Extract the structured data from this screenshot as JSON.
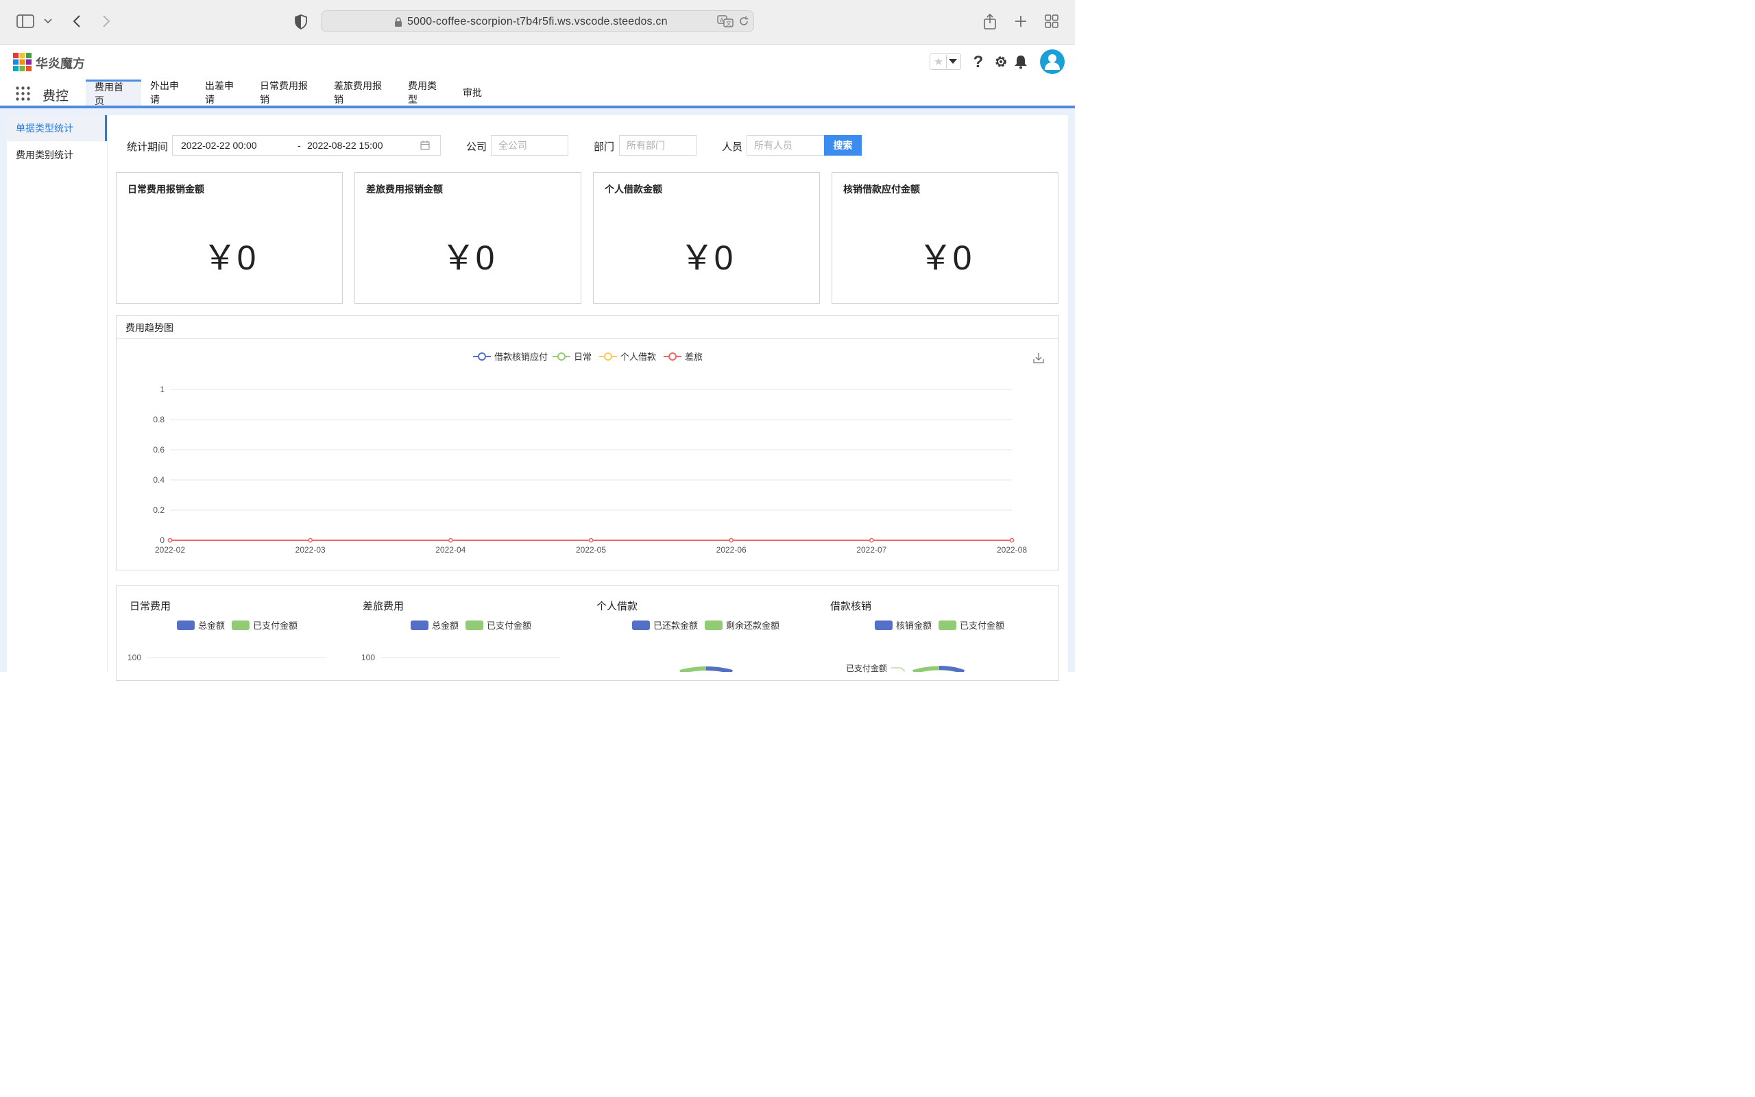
{
  "browser": {
    "url": "5000-coffee-scorpion-t7b4r5fi.ws.vscode.steedos.cn"
  },
  "app": {
    "brand": "华炎魔方",
    "title": "费控",
    "nav": [
      "费用首页",
      "外出申请",
      "出差申请",
      "日常费用报销",
      "差旅费用报销",
      "费用类型",
      "审批"
    ]
  },
  "sidebar": {
    "items": [
      "单据类型统计",
      "费用类别统计"
    ]
  },
  "filters": {
    "period_label": "统计期间",
    "start": "2022-02-22 00:00",
    "sep": "-",
    "end": "2022-08-22 15:00",
    "company_label": "公司",
    "company_placeholder": "全公司",
    "dept_label": "部门",
    "dept_placeholder": "所有部门",
    "person_label": "人员",
    "person_placeholder": "所有人员",
    "search": "搜索"
  },
  "cards": [
    {
      "title": "日常费用报销金额",
      "value": "￥0"
    },
    {
      "title": "差旅费用报销金额",
      "value": "￥0"
    },
    {
      "title": "个人借款金额",
      "value": "￥0"
    },
    {
      "title": "核销借款应付金额",
      "value": "￥0"
    }
  ],
  "trend": {
    "panel_title": "费用趋势图"
  },
  "chart_data": {
    "type": "line",
    "x": [
      "2022-02",
      "2022-03",
      "2022-04",
      "2022-05",
      "2022-06",
      "2022-07",
      "2022-08"
    ],
    "y_ticks": [
      "0",
      "0.2",
      "0.4",
      "0.6",
      "0.8",
      "1"
    ],
    "ylim": [
      0,
      1
    ],
    "grid": true,
    "legend_position": "top-center",
    "series": [
      {
        "name": "借款核销应付",
        "color": "#5470c6",
        "values": [
          0,
          0,
          0,
          0,
          0,
          0,
          0
        ]
      },
      {
        "name": "日常",
        "color": "#91cc75",
        "values": [
          0,
          0,
          0,
          0,
          0,
          0,
          0
        ]
      },
      {
        "name": "个人借款",
        "color": "#fac858",
        "values": [
          0,
          0,
          0,
          0,
          0,
          0,
          0
        ]
      },
      {
        "name": "差旅",
        "color": "#ee6666",
        "values": [
          0,
          0,
          0,
          0,
          0,
          0,
          0
        ]
      }
    ]
  },
  "bottom": {
    "charts": [
      {
        "title": "日常费用",
        "legend": [
          "总金额",
          "已支付金额"
        ],
        "tick": "100"
      },
      {
        "title": "差旅费用",
        "legend": [
          "总金额",
          "已支付金额"
        ],
        "tick": "100"
      },
      {
        "title": "个人借款",
        "legend": [
          "已还款金额",
          "剩余还款金额"
        ]
      },
      {
        "title": "借款核销",
        "legend": [
          "核销金额",
          "已支付金额"
        ],
        "pie_label": "已支付金额"
      }
    ],
    "colors": {
      "primary": "#5470c6",
      "secondary": "#91cc75"
    }
  }
}
